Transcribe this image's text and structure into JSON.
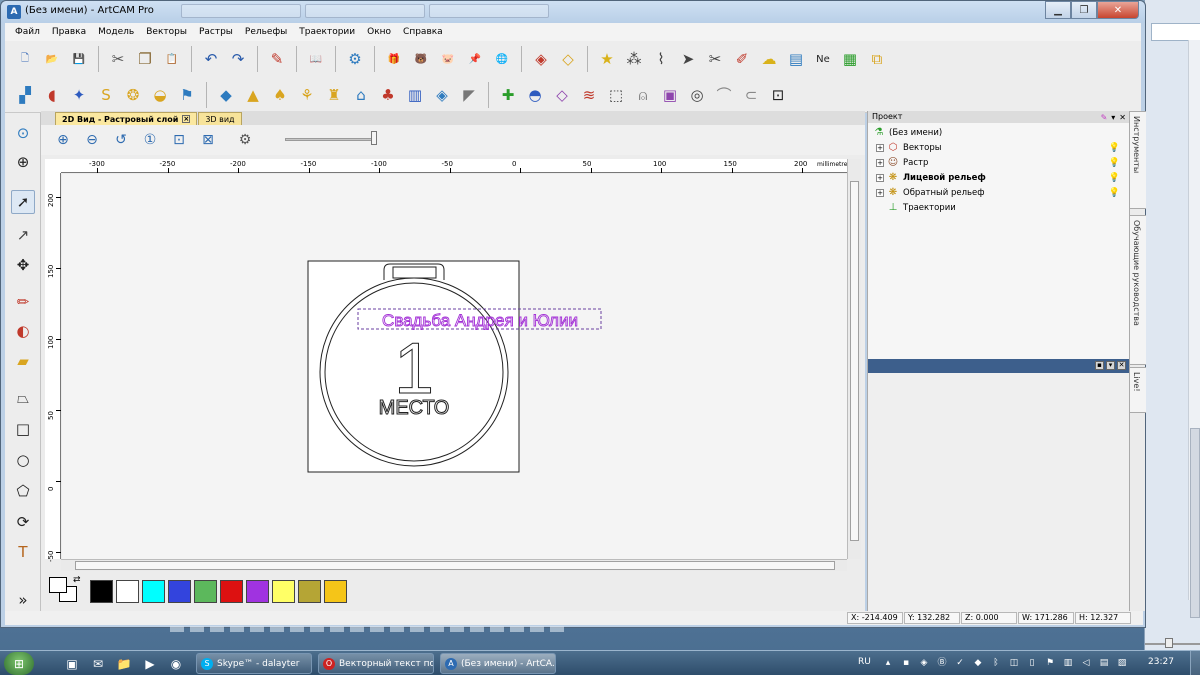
{
  "window": {
    "title": "(Без имени) - ArtCAM Pro",
    "app_icon_label": "A"
  },
  "menu": [
    "Файл",
    "Правка",
    "Модель",
    "Векторы",
    "Растры",
    "Рельефы",
    "Траектории",
    "Окно",
    "Справка"
  ],
  "toolbar1_icons": [
    {
      "name": "new-file-icon",
      "glyph": "🗋",
      "color": "#3a6bb8"
    },
    {
      "name": "open-folder-icon",
      "glyph": "📂",
      "color": "#d9a520"
    },
    {
      "name": "save-icon",
      "glyph": "💾",
      "color": "#2a5bab"
    },
    {
      "sep": true
    },
    {
      "name": "cut-icon",
      "glyph": "✂",
      "color": "#555"
    },
    {
      "name": "copy-icon",
      "glyph": "❐",
      "color": "#8a6d3b"
    },
    {
      "name": "paste-icon",
      "glyph": "📋",
      "color": "#b07a2a"
    },
    {
      "sep": true
    },
    {
      "name": "undo-icon",
      "glyph": "↶",
      "color": "#2a5bab"
    },
    {
      "name": "redo-icon",
      "glyph": "↷",
      "color": "#2a5bab"
    },
    {
      "sep": true
    },
    {
      "name": "notes-icon",
      "glyph": "✎",
      "color": "#c0392b"
    },
    {
      "sep": true
    },
    {
      "name": "book-icon",
      "glyph": "📖",
      "color": "#8e44ad"
    },
    {
      "sep": true
    },
    {
      "name": "model-wizard-icon",
      "glyph": "⚙",
      "color": "#2e7bbf"
    },
    {
      "sep": true
    },
    {
      "name": "relief-clipart-icon",
      "glyph": "🎁",
      "color": "#c0392b"
    },
    {
      "name": "bear-icon",
      "glyph": "🐻",
      "color": "#b5651d"
    },
    {
      "name": "piggy-icon",
      "glyph": "🐷",
      "color": "#777"
    },
    {
      "name": "pin-icon",
      "glyph": "📌",
      "color": "#c0392b"
    },
    {
      "name": "globe-icon",
      "glyph": "🌐",
      "color": "#2e7bbf"
    },
    {
      "sep": true
    },
    {
      "name": "rotate-relief-icon",
      "glyph": "◈",
      "color": "#c0392b"
    },
    {
      "name": "diamond-icon",
      "glyph": "◇",
      "color": "#d9a520"
    },
    {
      "sep": true
    },
    {
      "name": "star-tool-icon",
      "glyph": "★",
      "color": "#d9b21a"
    },
    {
      "name": "nodes-icon",
      "glyph": "⁂",
      "color": "#444"
    },
    {
      "name": "bezier-icon",
      "glyph": "⌇",
      "color": "#444"
    },
    {
      "name": "arrow-right-icon",
      "glyph": "➤",
      "color": "#444"
    },
    {
      "name": "trim-icon",
      "glyph": "✂",
      "color": "#444"
    },
    {
      "name": "fillet-icon",
      "glyph": "✐",
      "color": "#c0392b"
    },
    {
      "name": "bubble-icon",
      "glyph": "☁",
      "color": "#d9b21a"
    },
    {
      "name": "layers-icon",
      "glyph": "▤",
      "color": "#2e7bbf"
    },
    {
      "name": "nesting-icon",
      "glyph": "Ne",
      "color": "#222"
    },
    {
      "name": "text-block-icon",
      "glyph": "▦",
      "color": "#2a9d2a"
    },
    {
      "name": "stack-icon",
      "glyph": "⧉",
      "color": "#d9a520"
    }
  ],
  "toolbar2_icons": [
    {
      "name": "bitmap-to-vector-icon",
      "glyph": "▞",
      "color": "#2e7bbf"
    },
    {
      "name": "shield-icon",
      "glyph": "◖",
      "color": "#c0392b"
    },
    {
      "name": "star-blue-icon",
      "glyph": "✦",
      "color": "#2e5bbf"
    },
    {
      "name": "s-shape-icon",
      "glyph": "S",
      "color": "#d9a520"
    },
    {
      "name": "weave-icon",
      "glyph": "❂",
      "color": "#d9a520"
    },
    {
      "name": "relief-layer-icon",
      "glyph": "◒",
      "color": "#d9a520"
    },
    {
      "name": "flag-icon",
      "glyph": "⚑",
      "color": "#2e7bbf"
    },
    {
      "sep": true
    },
    {
      "name": "plane-icon",
      "glyph": "◆",
      "color": "#2e7bbf"
    },
    {
      "name": "cone-icon",
      "glyph": "▲",
      "color": "#d9a520"
    },
    {
      "name": "mushroom-icon",
      "glyph": "♠",
      "color": "#d9a520"
    },
    {
      "name": "sprout-icon",
      "glyph": "⚘",
      "color": "#d9a520"
    },
    {
      "name": "bottle-icon",
      "glyph": "♜",
      "color": "#d9a520"
    },
    {
      "name": "arch-icon",
      "glyph": "⌂",
      "color": "#2e7bbf"
    },
    {
      "name": "santa-icon",
      "glyph": "♣",
      "color": "#c0392b"
    },
    {
      "name": "column-icon",
      "glyph": "▥",
      "color": "#2e5bbf"
    },
    {
      "name": "box-icon",
      "glyph": "◈",
      "color": "#2e7bbf"
    },
    {
      "name": "ramp-icon",
      "glyph": "◤",
      "color": "#777"
    },
    {
      "sep": true
    },
    {
      "name": "add-relief-icon",
      "glyph": "✚",
      "color": "#2a9d2a"
    },
    {
      "name": "dish-icon",
      "glyph": "◓",
      "color": "#2e5bbf"
    },
    {
      "name": "inverse-icon",
      "glyph": "◇",
      "color": "#8e44ad"
    },
    {
      "name": "wave-icon",
      "glyph": "≋",
      "color": "#c0392b"
    },
    {
      "name": "dashed-shape-icon",
      "glyph": "⬚",
      "color": "#444"
    },
    {
      "name": "bell-icon",
      "glyph": "⍝",
      "color": "#777"
    },
    {
      "name": "frame-icon",
      "glyph": "▣",
      "color": "#8e44ad"
    },
    {
      "name": "select-relief-icon",
      "glyph": "◎",
      "color": "#444"
    },
    {
      "name": "curve-icon",
      "glyph": "⌒",
      "color": "#888"
    },
    {
      "name": "arc-icon",
      "glyph": "⊂",
      "color": "#888"
    },
    {
      "name": "bounding-box-icon",
      "glyph": "⊡",
      "color": "#222"
    }
  ],
  "left_tools": [
    {
      "name": "zoom-window-icon",
      "glyph": "⊙",
      "color": "#2e7bbf"
    },
    {
      "name": "sphere-view-icon",
      "glyph": "⊕",
      "color": "#222"
    },
    {
      "name": "select-arrow-icon",
      "glyph": "➚",
      "color": "#222"
    },
    {
      "name": "node-edit-icon",
      "glyph": "↗",
      "color": "#444"
    },
    {
      "name": "transform-icon",
      "glyph": "✥",
      "color": "#222"
    },
    {
      "name": "pencil-icon",
      "glyph": "✏",
      "color": "#c0392b"
    },
    {
      "name": "paint-bucket-icon",
      "glyph": "◐",
      "color": "#c0392b"
    },
    {
      "name": "eraser-icon",
      "glyph": "▰",
      "color": "#d9a520"
    },
    {
      "name": "polyline-icon",
      "glyph": "⏢",
      "color": "#222"
    },
    {
      "name": "rectangle-icon",
      "glyph": "□",
      "color": "#222"
    },
    {
      "name": "circle-icon",
      "glyph": "○",
      "color": "#222"
    },
    {
      "name": "polygon-icon",
      "glyph": "⬠",
      "color": "#222"
    },
    {
      "name": "arc-tool-icon",
      "glyph": "⟳",
      "color": "#222"
    },
    {
      "name": "text-tool-icon",
      "glyph": "T",
      "color": "#b5651d"
    },
    {
      "name": "more-tools-icon",
      "glyph": "»",
      "color": "#222"
    }
  ],
  "doc_tabs": [
    {
      "label": "2D Вид - Растровый слой",
      "active": true
    },
    {
      "label": "3D вид",
      "active": false
    }
  ],
  "view_tools": [
    {
      "name": "zoom-in-icon",
      "glyph": "⊕"
    },
    {
      "name": "zoom-out-icon",
      "glyph": "⊖"
    },
    {
      "name": "zoom-previous-icon",
      "glyph": "↺"
    },
    {
      "name": "zoom-1to1-icon",
      "glyph": "①"
    },
    {
      "name": "zoom-selection-icon",
      "glyph": "⊡"
    },
    {
      "name": "zoom-fit-icon",
      "glyph": "⊠"
    },
    {
      "name": "view-settings-icon",
      "glyph": "⚙"
    }
  ],
  "ruler": {
    "h_labels": [
      "-300",
      "-250",
      "-200",
      "-150",
      "-100",
      "-50",
      "0",
      "50",
      "100",
      "150",
      "200"
    ],
    "units": "millimetres",
    "v_labels": [
      "200",
      "150",
      "100",
      "50",
      "0",
      "-50"
    ]
  },
  "drawing": {
    "arc_text": "Свадьба Андрея и Юлии",
    "number": "1",
    "caption": "МЕСТО",
    "accent_text_color": "#a330d6"
  },
  "palette": [
    "#000000",
    "#ffffff",
    "#00ffff",
    "#3344dd",
    "#5cb85c",
    "#dd1111",
    "#a033e0",
    "#ffff66",
    "#b5a535",
    "#f5c518"
  ],
  "project": {
    "header": "Проект",
    "root": "(Без имени)",
    "items": [
      {
        "label": "Векторы",
        "bold": false,
        "icon": "vectors-icon",
        "glyph": "⬡",
        "color": "#c0392b"
      },
      {
        "label": "Растр",
        "bold": false,
        "icon": "bitmap-icon",
        "glyph": "☺",
        "color": "#8a4b2a"
      },
      {
        "label": "Лицевой рельеф",
        "bold": true,
        "icon": "front-relief-icon",
        "glyph": "❋",
        "color": "#c08a00"
      },
      {
        "label": "Обратный рельеф",
        "bold": false,
        "icon": "back-relief-icon",
        "glyph": "❋",
        "color": "#c08a00"
      },
      {
        "label": "Траектории",
        "bold": false,
        "icon": "toolpaths-icon",
        "glyph": "⊥",
        "color": "#2a9d2a"
      }
    ]
  },
  "side_tabs": [
    "Инструменты",
    "Обучающие руководства",
    "Live!"
  ],
  "status": {
    "x": "X: -214.409",
    "y": "Y: 132.282",
    "z": "Z: 0.000",
    "w": "W: 171.286",
    "h": "H: 12.327"
  },
  "taskbar": {
    "tasks": [
      {
        "label": "Skype™ - dalayter",
        "icon_color": "#00aff0",
        "glyph": "S"
      },
      {
        "label": "Векторный текст по...",
        "icon_color": "#cc2222",
        "glyph": "O"
      },
      {
        "label": "(Без имени) - ArtCA...",
        "icon_color": "#2d6bb2",
        "glyph": "A"
      }
    ],
    "lang": "RU",
    "clock": "23:27"
  }
}
